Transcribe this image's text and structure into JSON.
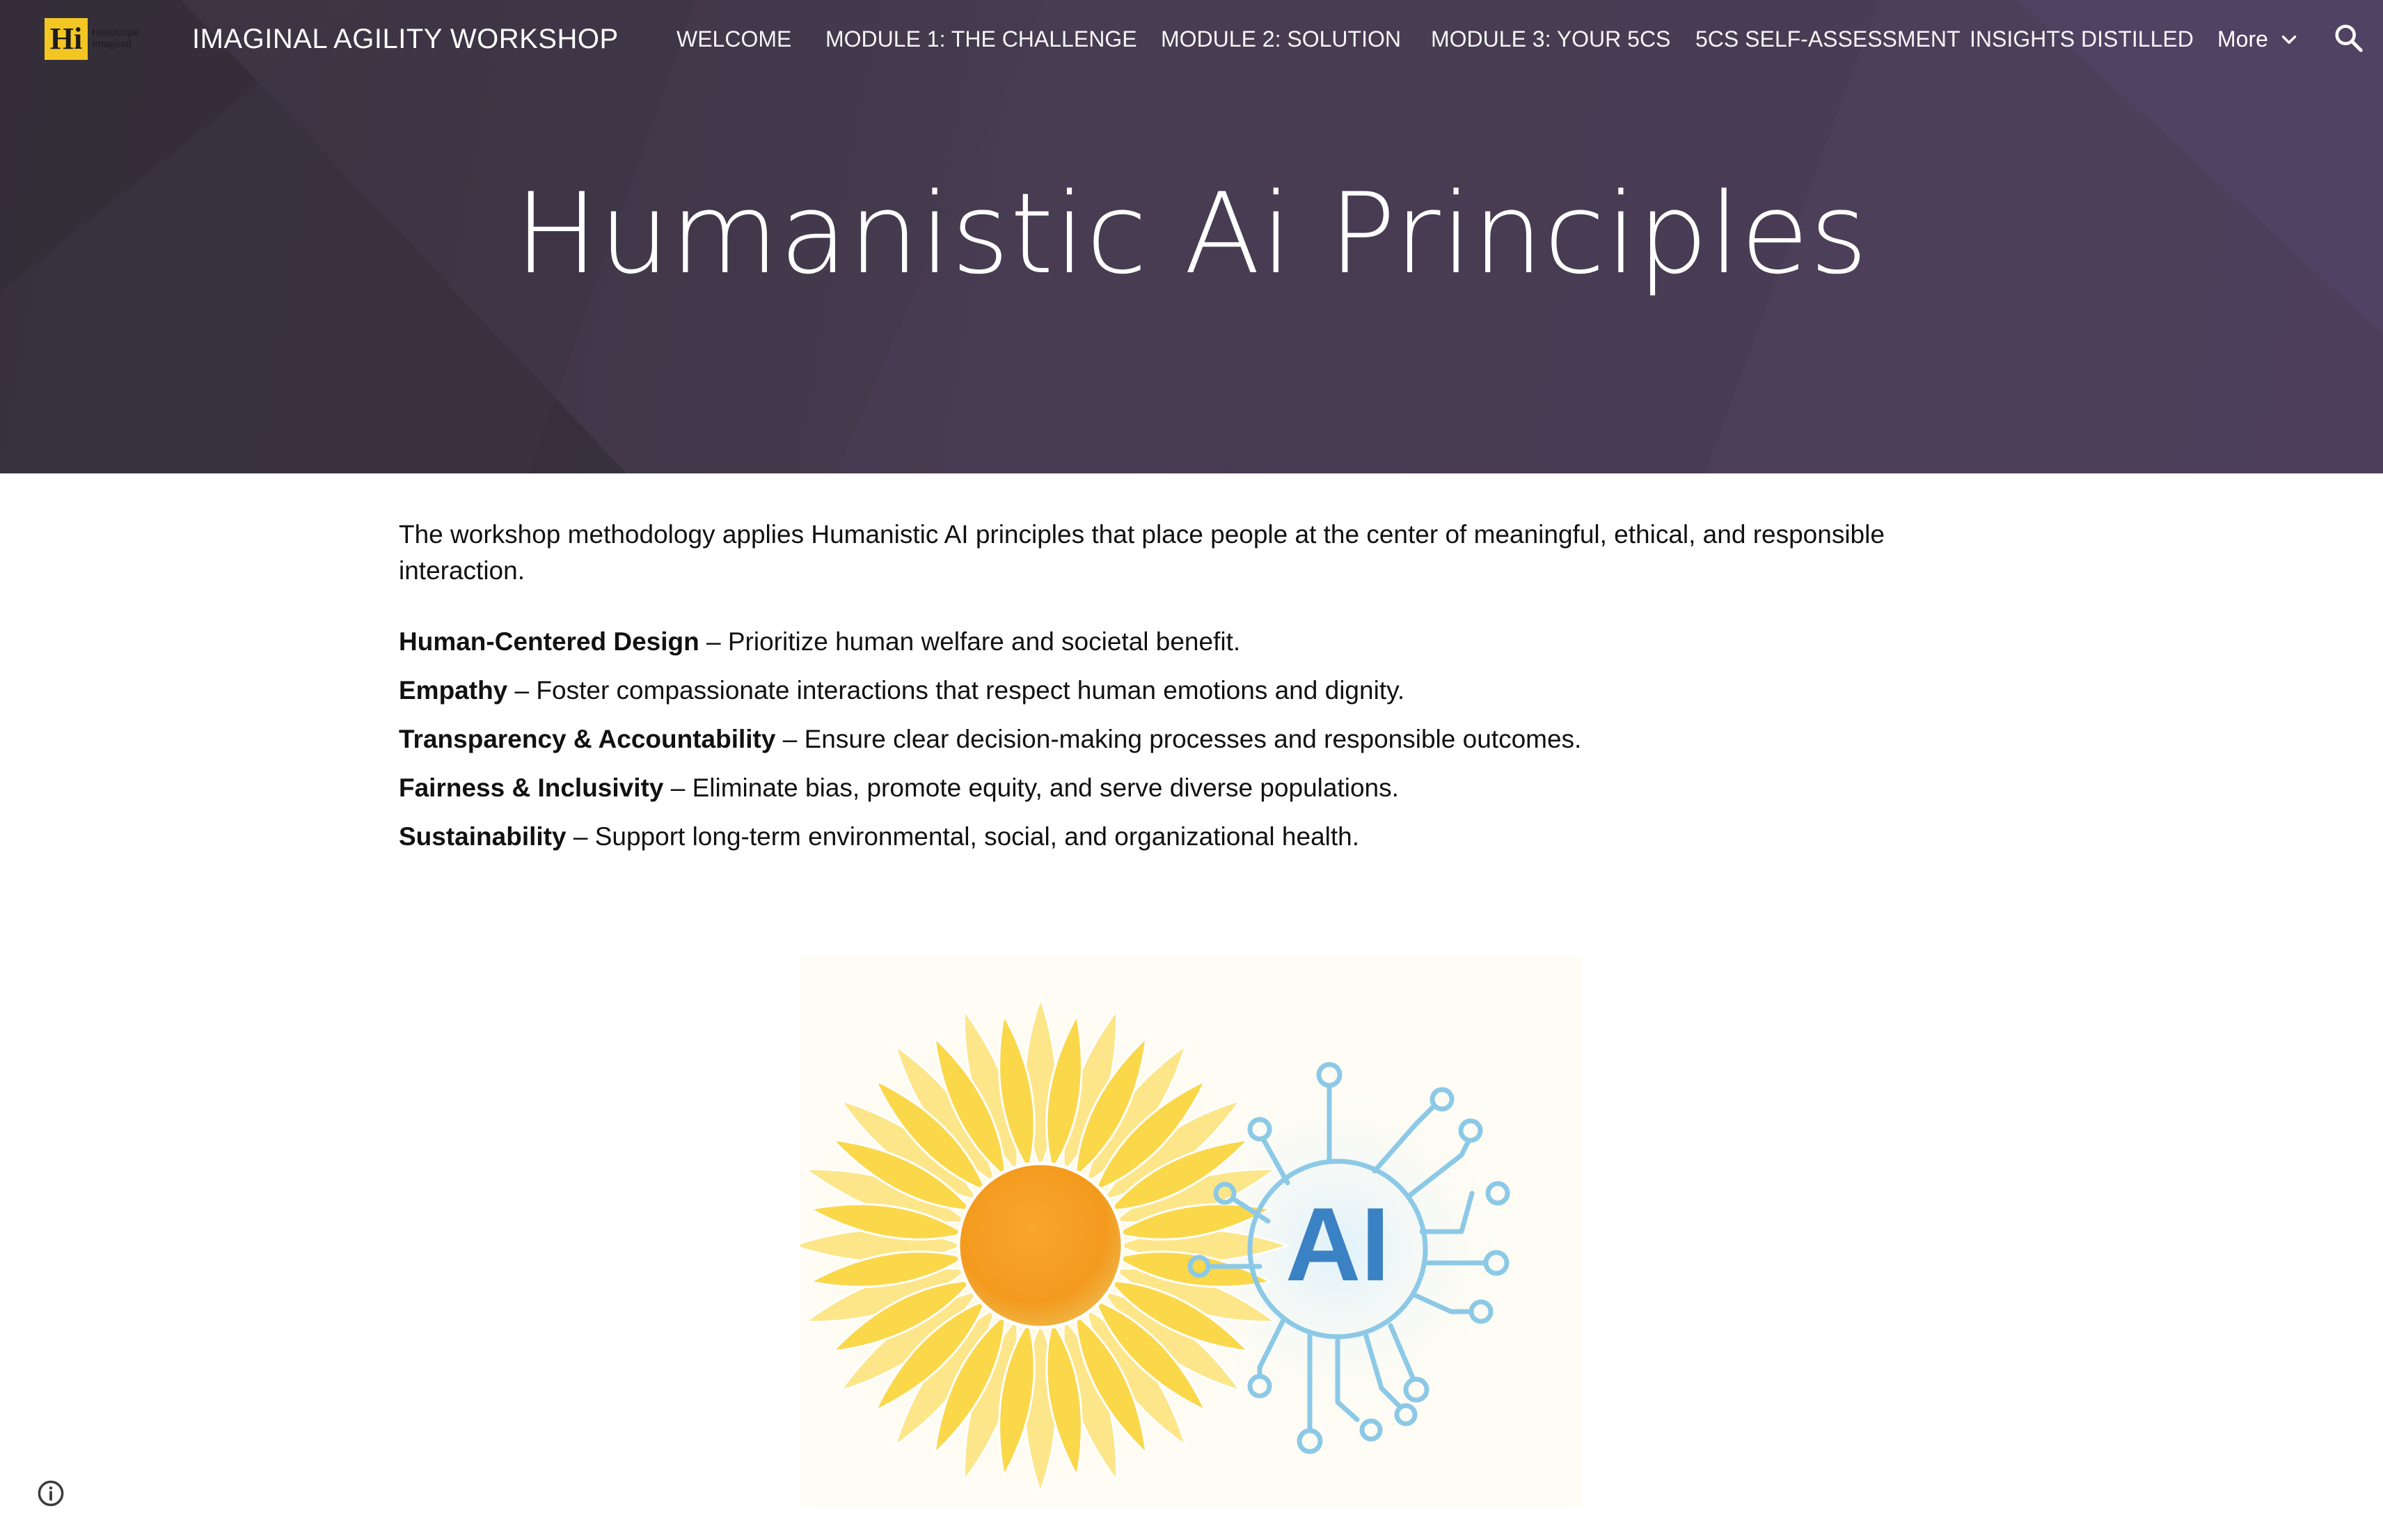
{
  "header": {
    "logo_text": "Hi",
    "logo_subtitle": "Heliotrope Imaginal",
    "site_title": "IMAGINAL AGILITY WORKSHOP",
    "nav": [
      {
        "label": "WELCOME"
      },
      {
        "label": "MODULE 1: THE CHALLENGE"
      },
      {
        "label": "MODULE 2: SOLUTION"
      },
      {
        "label": "MODULE 3: YOUR 5CS"
      },
      {
        "label": "5CS SELF-ASSESSMENT"
      },
      {
        "label": "INSIGHTS DISTILLED"
      }
    ],
    "more_label": "More",
    "icons": {
      "more": "chevron-down-icon",
      "search": "search-icon"
    }
  },
  "hero": {
    "title": "Humanistic Ai Principles"
  },
  "content": {
    "intro": "The workshop methodology applies Humanistic AI principles that place people at the center of meaningful, ethical, and responsible interaction.",
    "principles": [
      {
        "term": "Human-Centered Design",
        "desc": " – Prioritize human welfare and societal benefit."
      },
      {
        "term": "Empathy",
        "desc": " – Foster compassionate interactions that respect human emotions and dignity."
      },
      {
        "term": "Transparency & Accountability",
        "desc": " – Ensure clear decision-making processes and responsible outcomes."
      },
      {
        "term": "Fairness & Inclusivity",
        "desc": " – Eliminate bias, promote equity, and serve diverse populations."
      },
      {
        "term": "Sustainability",
        "desc": " – Support long-term environmental, social, and organizational health."
      }
    ],
    "illustration": {
      "ai_text": "AI"
    }
  },
  "footer": {
    "info_icon": "info-icon"
  },
  "colors": {
    "hero_bg": "#463b50",
    "logo_yellow": "#f3c623",
    "petal_yellow": "#fbd74a",
    "sun_orange": "#f39a1e",
    "circuit_blue": "#8cc9e6",
    "ai_text_blue": "#3b82c4"
  }
}
